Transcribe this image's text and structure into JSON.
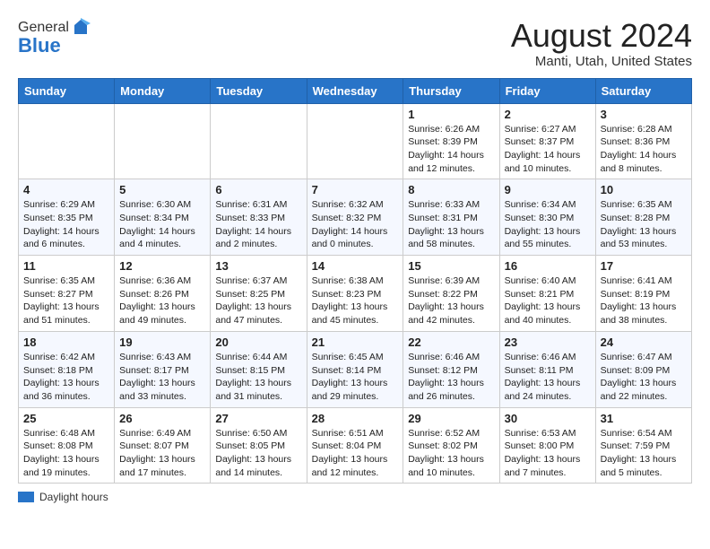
{
  "header": {
    "logo_general": "General",
    "logo_blue": "Blue",
    "month_year": "August 2024",
    "location": "Manti, Utah, United States"
  },
  "legend": {
    "label": "Daylight hours"
  },
  "days_of_week": [
    "Sunday",
    "Monday",
    "Tuesday",
    "Wednesday",
    "Thursday",
    "Friday",
    "Saturday"
  ],
  "weeks": [
    [
      {
        "day": "",
        "info": ""
      },
      {
        "day": "",
        "info": ""
      },
      {
        "day": "",
        "info": ""
      },
      {
        "day": "",
        "info": ""
      },
      {
        "day": "1",
        "info": "Sunrise: 6:26 AM\nSunset: 8:39 PM\nDaylight: 14 hours and 12 minutes."
      },
      {
        "day": "2",
        "info": "Sunrise: 6:27 AM\nSunset: 8:37 PM\nDaylight: 14 hours and 10 minutes."
      },
      {
        "day": "3",
        "info": "Sunrise: 6:28 AM\nSunset: 8:36 PM\nDaylight: 14 hours and 8 minutes."
      }
    ],
    [
      {
        "day": "4",
        "info": "Sunrise: 6:29 AM\nSunset: 8:35 PM\nDaylight: 14 hours and 6 minutes."
      },
      {
        "day": "5",
        "info": "Sunrise: 6:30 AM\nSunset: 8:34 PM\nDaylight: 14 hours and 4 minutes."
      },
      {
        "day": "6",
        "info": "Sunrise: 6:31 AM\nSunset: 8:33 PM\nDaylight: 14 hours and 2 minutes."
      },
      {
        "day": "7",
        "info": "Sunrise: 6:32 AM\nSunset: 8:32 PM\nDaylight: 14 hours and 0 minutes."
      },
      {
        "day": "8",
        "info": "Sunrise: 6:33 AM\nSunset: 8:31 PM\nDaylight: 13 hours and 58 minutes."
      },
      {
        "day": "9",
        "info": "Sunrise: 6:34 AM\nSunset: 8:30 PM\nDaylight: 13 hours and 55 minutes."
      },
      {
        "day": "10",
        "info": "Sunrise: 6:35 AM\nSunset: 8:28 PM\nDaylight: 13 hours and 53 minutes."
      }
    ],
    [
      {
        "day": "11",
        "info": "Sunrise: 6:35 AM\nSunset: 8:27 PM\nDaylight: 13 hours and 51 minutes."
      },
      {
        "day": "12",
        "info": "Sunrise: 6:36 AM\nSunset: 8:26 PM\nDaylight: 13 hours and 49 minutes."
      },
      {
        "day": "13",
        "info": "Sunrise: 6:37 AM\nSunset: 8:25 PM\nDaylight: 13 hours and 47 minutes."
      },
      {
        "day": "14",
        "info": "Sunrise: 6:38 AM\nSunset: 8:23 PM\nDaylight: 13 hours and 45 minutes."
      },
      {
        "day": "15",
        "info": "Sunrise: 6:39 AM\nSunset: 8:22 PM\nDaylight: 13 hours and 42 minutes."
      },
      {
        "day": "16",
        "info": "Sunrise: 6:40 AM\nSunset: 8:21 PM\nDaylight: 13 hours and 40 minutes."
      },
      {
        "day": "17",
        "info": "Sunrise: 6:41 AM\nSunset: 8:19 PM\nDaylight: 13 hours and 38 minutes."
      }
    ],
    [
      {
        "day": "18",
        "info": "Sunrise: 6:42 AM\nSunset: 8:18 PM\nDaylight: 13 hours and 36 minutes."
      },
      {
        "day": "19",
        "info": "Sunrise: 6:43 AM\nSunset: 8:17 PM\nDaylight: 13 hours and 33 minutes."
      },
      {
        "day": "20",
        "info": "Sunrise: 6:44 AM\nSunset: 8:15 PM\nDaylight: 13 hours and 31 minutes."
      },
      {
        "day": "21",
        "info": "Sunrise: 6:45 AM\nSunset: 8:14 PM\nDaylight: 13 hours and 29 minutes."
      },
      {
        "day": "22",
        "info": "Sunrise: 6:46 AM\nSunset: 8:12 PM\nDaylight: 13 hours and 26 minutes."
      },
      {
        "day": "23",
        "info": "Sunrise: 6:46 AM\nSunset: 8:11 PM\nDaylight: 13 hours and 24 minutes."
      },
      {
        "day": "24",
        "info": "Sunrise: 6:47 AM\nSunset: 8:09 PM\nDaylight: 13 hours and 22 minutes."
      }
    ],
    [
      {
        "day": "25",
        "info": "Sunrise: 6:48 AM\nSunset: 8:08 PM\nDaylight: 13 hours and 19 minutes."
      },
      {
        "day": "26",
        "info": "Sunrise: 6:49 AM\nSunset: 8:07 PM\nDaylight: 13 hours and 17 minutes."
      },
      {
        "day": "27",
        "info": "Sunrise: 6:50 AM\nSunset: 8:05 PM\nDaylight: 13 hours and 14 minutes."
      },
      {
        "day": "28",
        "info": "Sunrise: 6:51 AM\nSunset: 8:04 PM\nDaylight: 13 hours and 12 minutes."
      },
      {
        "day": "29",
        "info": "Sunrise: 6:52 AM\nSunset: 8:02 PM\nDaylight: 13 hours and 10 minutes."
      },
      {
        "day": "30",
        "info": "Sunrise: 6:53 AM\nSunset: 8:00 PM\nDaylight: 13 hours and 7 minutes."
      },
      {
        "day": "31",
        "info": "Sunrise: 6:54 AM\nSunset: 7:59 PM\nDaylight: 13 hours and 5 minutes."
      }
    ]
  ]
}
